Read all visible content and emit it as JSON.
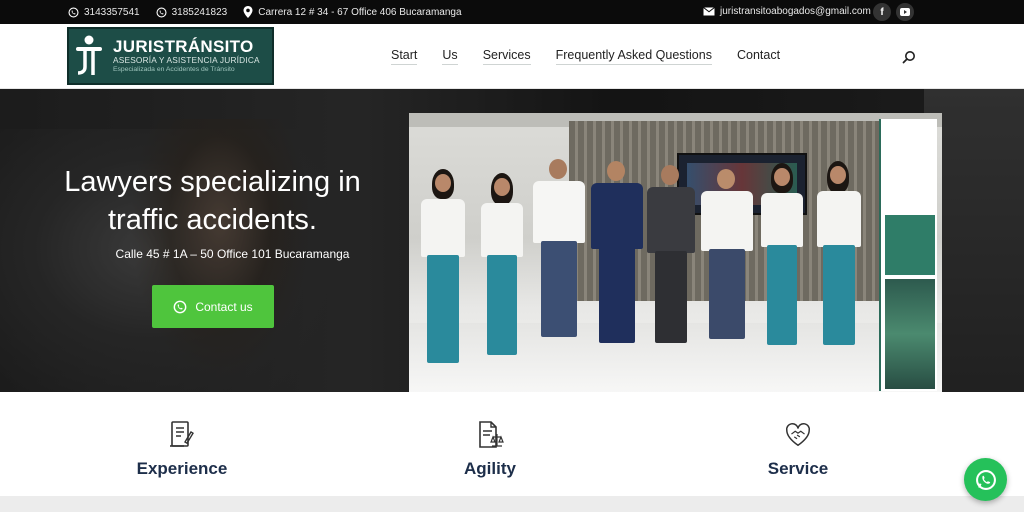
{
  "topbar": {
    "phone1": "3143357541",
    "phone2": "3185241823",
    "address": "Carrera 12 # 34 - 67 Office 406 Bucaramanga",
    "email": "juristransitoabogados@gmail.com",
    "social": [
      "facebook-icon",
      "youtube-icon"
    ]
  },
  "logo": {
    "title": "JURISTRÁNSITO",
    "subtitle": "ASESORÍA Y ASISTENCIA JURÍDICA",
    "tagline": "Especializada en Accidentes de Tránsito"
  },
  "nav": {
    "items": [
      "Start",
      "Us",
      "Services",
      "Frequently Asked Questions",
      "Contact"
    ]
  },
  "hero": {
    "title_line1": "Lawyers specializing in",
    "title_line2": "traffic accidents.",
    "address": "Calle 45 # 1A – 50 Office 101 Bucaramanga",
    "cta_label": "Contact us"
  },
  "features": [
    {
      "label": "Experience",
      "icon": "document-pen-icon"
    },
    {
      "label": "Agility",
      "icon": "document-scale-icon"
    },
    {
      "label": "Service",
      "icon": "handshake-heart-icon"
    }
  ],
  "colors": {
    "accent_green": "#4fc53d",
    "logo_bg": "#1d4d47",
    "feature_text": "#1d2e4a",
    "whatsapp": "#25c15a"
  }
}
